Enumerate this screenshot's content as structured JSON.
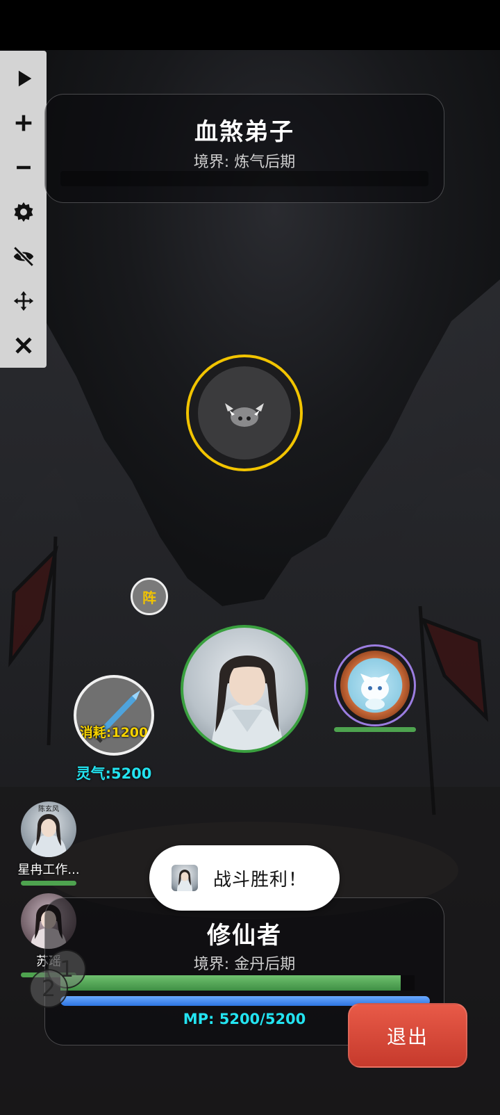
{
  "toolbar": {
    "items": [
      {
        "icon": "play-icon"
      },
      {
        "icon": "plus-icon"
      },
      {
        "icon": "minus-icon"
      },
      {
        "icon": "gear-icon"
      },
      {
        "icon": "eye-off-icon"
      },
      {
        "icon": "move-icon"
      },
      {
        "icon": "close-icon"
      }
    ]
  },
  "enemy": {
    "name": "血煞弟子",
    "realm": "境界: 炼气后期",
    "icon": "boar-icon",
    "ring_color": "#f2c400"
  },
  "formation": {
    "label": "阵"
  },
  "skill": {
    "cost": "消耗:1200",
    "icon": "sword-icon"
  },
  "spirit": {
    "label": "灵气:5200"
  },
  "pet": {
    "hp_fraction": 1.0,
    "icon": "white-fox-icon"
  },
  "teammates": [
    {
      "name": "星冉工作...",
      "hp_fraction": 1.0,
      "avatar_text": "陈玄风"
    },
    {
      "name": "苏瑶",
      "hp_fraction": 1.0
    }
  ],
  "toast": {
    "message": "战斗胜利！"
  },
  "player": {
    "name": "修仙者",
    "realm": "境界: 金丹后期",
    "hp_fraction": 0.96,
    "mp_fraction": 1.0,
    "mp_text": "MP: 5200/5200"
  },
  "numbers": [
    "1",
    "2"
  ],
  "exit": {
    "label": "退出"
  }
}
